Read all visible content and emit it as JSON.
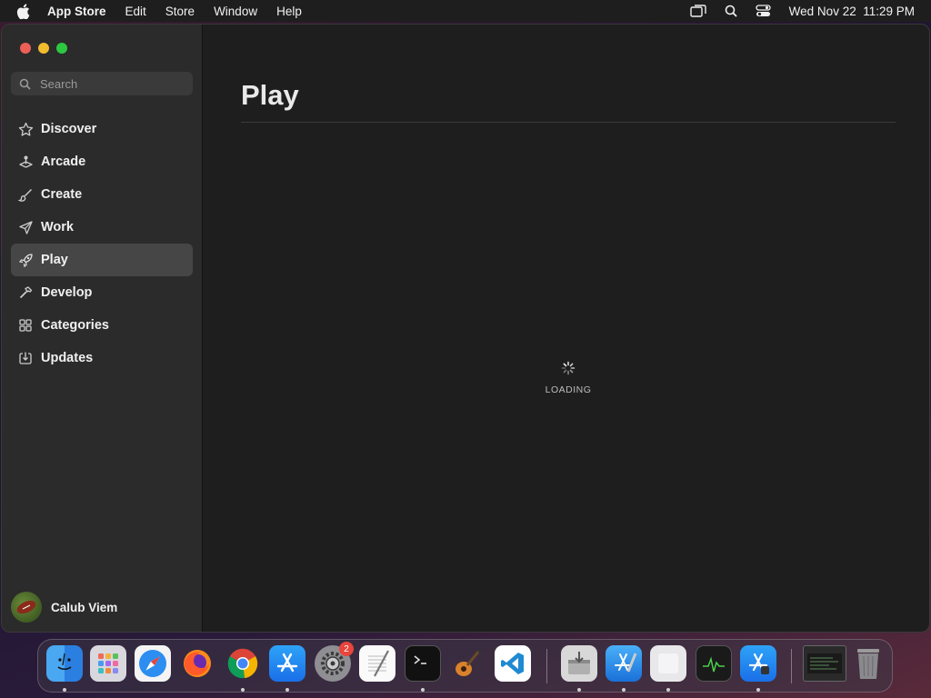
{
  "menubar": {
    "app_name": "App Store",
    "items": [
      "Edit",
      "Store",
      "Window",
      "Help"
    ],
    "clock": "Wed Nov 22  11:29 PM",
    "icons": [
      "apple-icon",
      "screen-mirroring-icon",
      "spotlight-search-icon",
      "control-center-icon"
    ]
  },
  "sidebar": {
    "search_placeholder": "Search",
    "items": [
      {
        "label": "Discover",
        "icon": "star-icon"
      },
      {
        "label": "Arcade",
        "icon": "joystick-icon"
      },
      {
        "label": "Create",
        "icon": "brush-icon"
      },
      {
        "label": "Work",
        "icon": "paper-plane-icon"
      },
      {
        "label": "Play",
        "icon": "rocket-icon",
        "active": true
      },
      {
        "label": "Develop",
        "icon": "hammer-icon"
      },
      {
        "label": "Categories",
        "icon": "grid-icon"
      },
      {
        "label": "Updates",
        "icon": "download-icon"
      }
    ],
    "user_name": "Calub Viem"
  },
  "main": {
    "title": "Play",
    "loading_text": "LOADING"
  },
  "dock": {
    "apps": [
      {
        "name": "Finder",
        "running": true
      },
      {
        "name": "Launchpad",
        "running": false
      },
      {
        "name": "Safari",
        "running": false
      },
      {
        "name": "Firefox",
        "running": false
      },
      {
        "name": "Chrome",
        "running": true
      },
      {
        "name": "App Store",
        "running": true
      },
      {
        "name": "System Settings",
        "running": false,
        "badge": "2"
      },
      {
        "name": "TextEdit",
        "running": false
      },
      {
        "name": "Terminal",
        "running": true
      },
      {
        "name": "GarageBand",
        "running": false
      },
      {
        "name": "Visual Studio Code",
        "running": false
      },
      {
        "name": "Installer",
        "running": true
      },
      {
        "name": "Xcode",
        "running": true
      },
      {
        "name": "Preview",
        "running": true
      },
      {
        "name": "Activity Monitor",
        "running": false
      },
      {
        "name": "Simulator",
        "running": true
      },
      {
        "name": "Recent Window",
        "running": false
      },
      {
        "name": "Trash",
        "running": false
      }
    ]
  },
  "colors": {
    "sidebar_bg": "#2b2b2b",
    "main_bg": "#1e1e1e",
    "active_item": "#464646",
    "close": "#ec5f57",
    "minimize": "#f1bc2e",
    "maximize": "#2cc840"
  }
}
